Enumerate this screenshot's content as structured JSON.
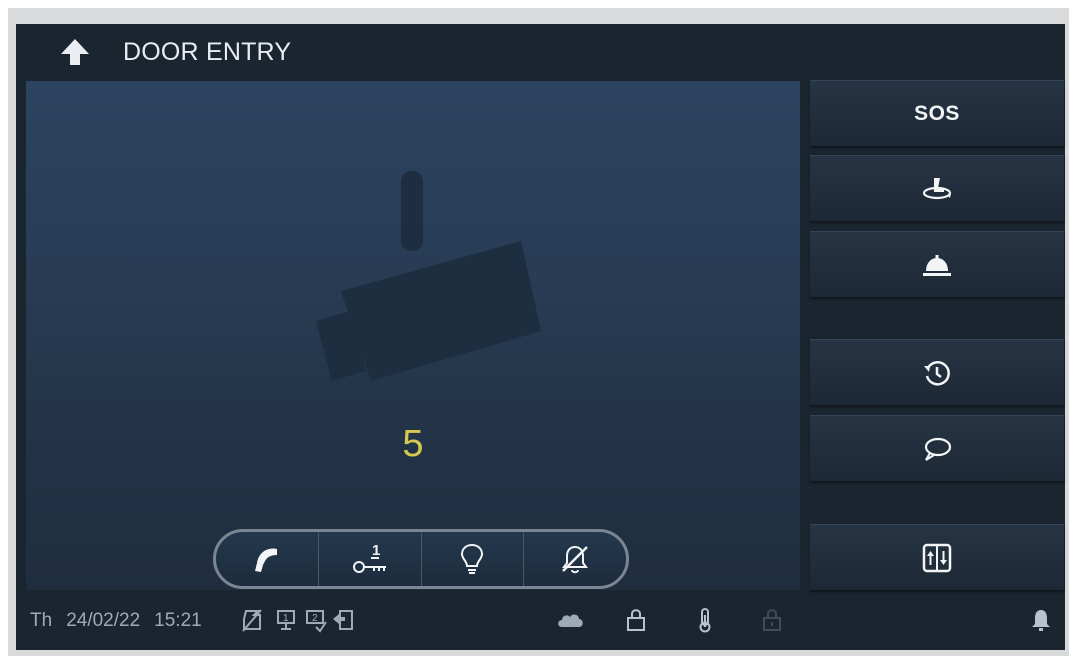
{
  "header": {
    "title": "DOOR ENTRY",
    "back_icon": "back-arrow-icon"
  },
  "video": {
    "placeholder_icon": "camera-icon",
    "countdown": "5"
  },
  "controls": [
    {
      "name": "answer-call-button",
      "icon": "phone-handset-icon"
    },
    {
      "name": "unlock-door-1-button",
      "icon": "key-1-icon"
    },
    {
      "name": "light-button",
      "icon": "light-bulb-icon"
    },
    {
      "name": "mute-ringtone-button",
      "icon": "bell-off-icon"
    }
  ],
  "side_buttons": [
    {
      "name": "sos-button",
      "label": "SOS"
    },
    {
      "name": "surveillance-button",
      "icon": "camera-rotate-icon"
    },
    {
      "name": "concierge-button",
      "icon": "service-bell-icon"
    },
    {
      "name": "history-button",
      "icon": "history-clock-icon"
    },
    {
      "name": "message-button",
      "icon": "speech-bubble-icon"
    },
    {
      "name": "elevator-button",
      "icon": "elevator-icon"
    }
  ],
  "status": {
    "day": "Th",
    "date": "24/02/22",
    "time": "15:21",
    "icons": [
      "mute-icon",
      "door-1-icon",
      "door-2-icon",
      "door-return-icon",
      "cloud-icon",
      "lock-icon",
      "thermometer-icon",
      "lock-inactive-icon",
      "bell-icon"
    ]
  },
  "colors": {
    "screen_bg": "#1b2530",
    "video_bg": "#2c4460",
    "accent_countdown": "#d7c84f",
    "text_primary": "#e9edf1",
    "status_text": "#9eaab6"
  }
}
